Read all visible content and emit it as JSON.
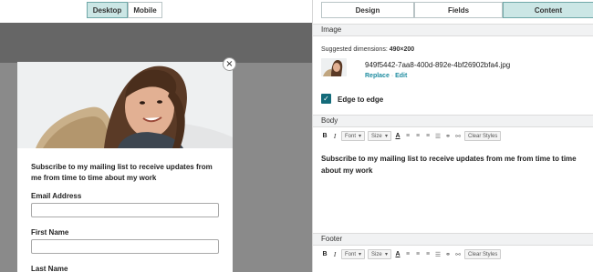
{
  "preview": {
    "devices": [
      "Desktop",
      "Mobile"
    ],
    "active_device": "Desktop",
    "close_label": "×",
    "body_text": "Subscribe to my mailing list to receive updates from me from time to time about my work",
    "fields": [
      "Email Address",
      "First Name",
      "Last Name"
    ]
  },
  "tabs": [
    "Design",
    "Fields",
    "Content"
  ],
  "active_tab": "Content",
  "image_section": {
    "heading": "Image",
    "suggested_label": "Suggested dimensions:",
    "suggested_value": "490×200",
    "filename": "949f5442-7aa8-400d-892e-4bf26902bfa4.jpg",
    "replace": "Replace",
    "separator": "·",
    "edit": "Edit",
    "edge_label": "Edge to edge",
    "edge_checked": true
  },
  "body_section": {
    "heading": "Body",
    "content": "Subscribe to my mailing list to receive updates from me from time to time about my work"
  },
  "footer_section": {
    "heading": "Footer"
  },
  "toolbar": {
    "bold": "B",
    "italic": "I",
    "font": "Font",
    "size": "Size",
    "color": "A",
    "clear": "Clear Styles"
  },
  "colors": {
    "accent": "#146b7a",
    "link": "#1e8ca0",
    "active_tab_bg": "#cbe6e5"
  }
}
